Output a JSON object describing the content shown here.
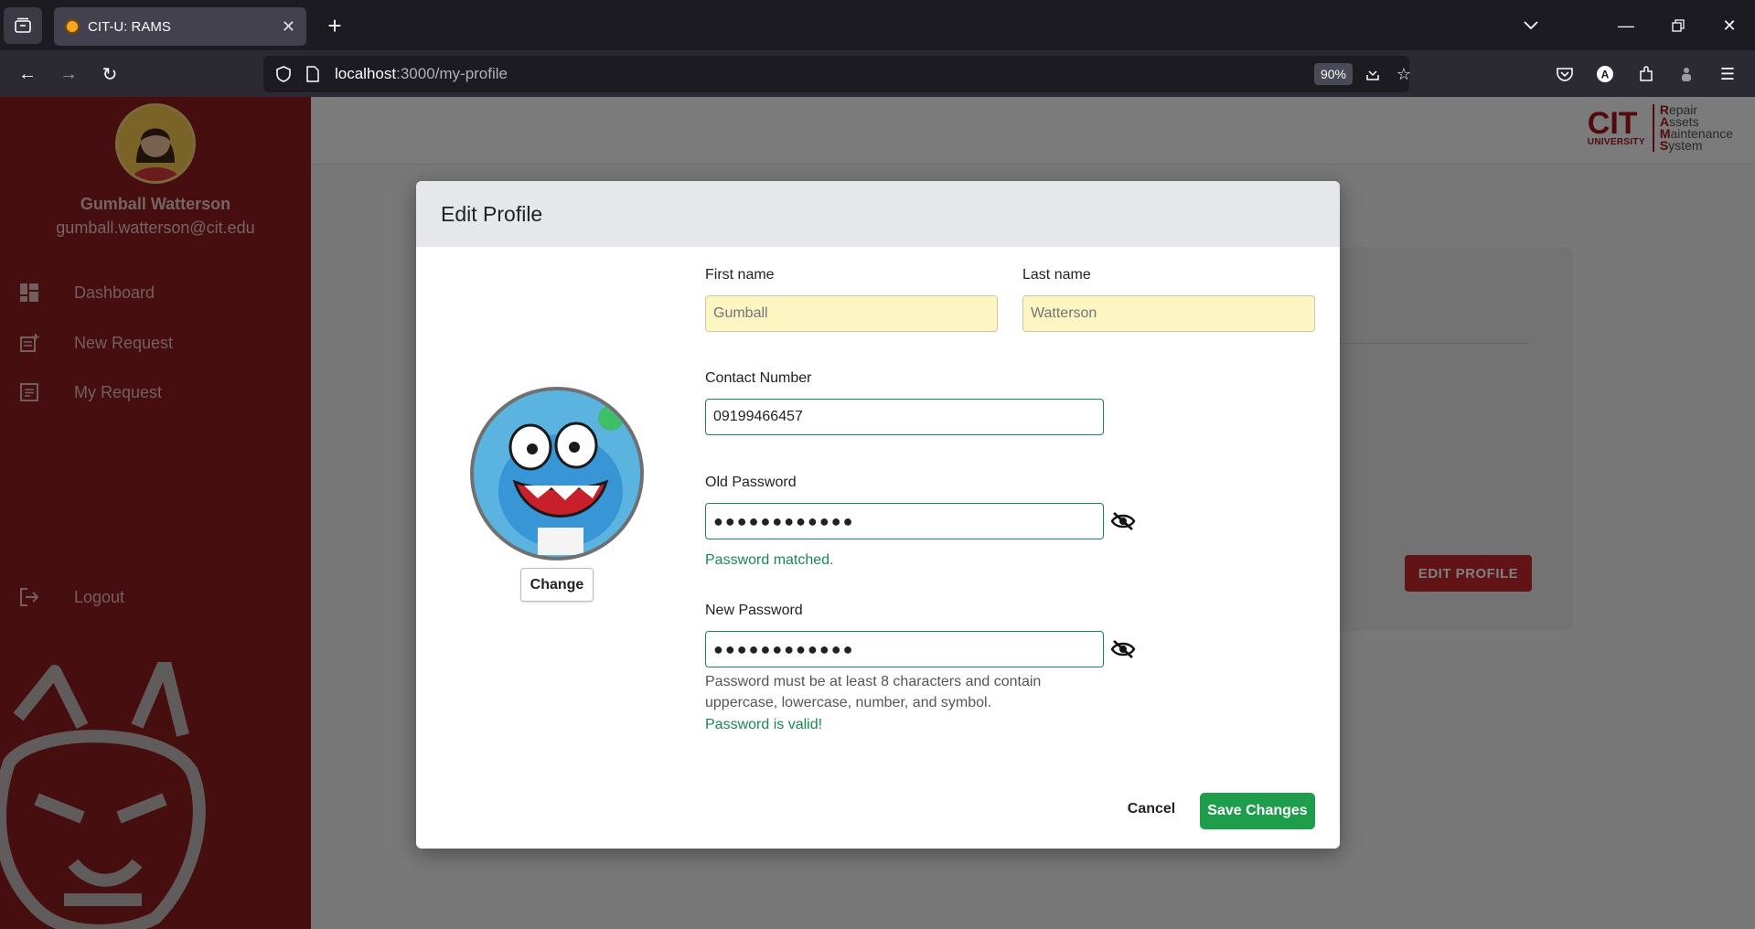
{
  "browser": {
    "tab_title": "CIT-U: RAMS",
    "url_host": "localhost",
    "url_path": ":3000/my-profile",
    "zoom": "90%"
  },
  "sidebar": {
    "user_name": "Gumball Watterson",
    "user_email": "gumball.watterson@cit.edu",
    "items": [
      {
        "label": "Dashboard",
        "icon": "dashboard-icon"
      },
      {
        "label": "New Request",
        "icon": "new-request-icon"
      },
      {
        "label": "My Request",
        "icon": "list-icon"
      }
    ],
    "logout_label": "Logout",
    "colors": {
      "background": "#8c1c1c"
    }
  },
  "logo": {
    "cit": "CIT",
    "university": "UNIVERSITY",
    "rams_lines": [
      {
        "initial": "R",
        "rest": "epair"
      },
      {
        "initial": "A",
        "rest": "ssets"
      },
      {
        "initial": "M",
        "rest": "aintenance"
      },
      {
        "initial": "S",
        "rest": "ystem"
      }
    ]
  },
  "background_page": {
    "edit_profile_label": "EDIT PROFILE"
  },
  "modal": {
    "title": "Edit Profile",
    "change_photo_label": "Change",
    "first_name": {
      "label": "First name",
      "placeholder": "Gumball"
    },
    "last_name": {
      "label": "Last name",
      "placeholder": "Watterson"
    },
    "contact": {
      "label": "Contact Number",
      "value": "09199466457"
    },
    "old_password": {
      "label": "Old Password",
      "value": "●●●●●●●●●●●●",
      "status": "Password matched."
    },
    "new_password": {
      "label": "New Password",
      "value": "●●●●●●●●●●●●",
      "hint_line1": "Password must be at least 8 characters and contain",
      "hint_line2": "uppercase, lowercase, number, and symbol.",
      "status": "Password is valid!"
    },
    "cancel_label": "Cancel",
    "save_label": "Save Changes",
    "colors": {
      "success": "#198754",
      "save_button": "#1e9e4a",
      "readonly_field": "#fdf6c3"
    }
  }
}
